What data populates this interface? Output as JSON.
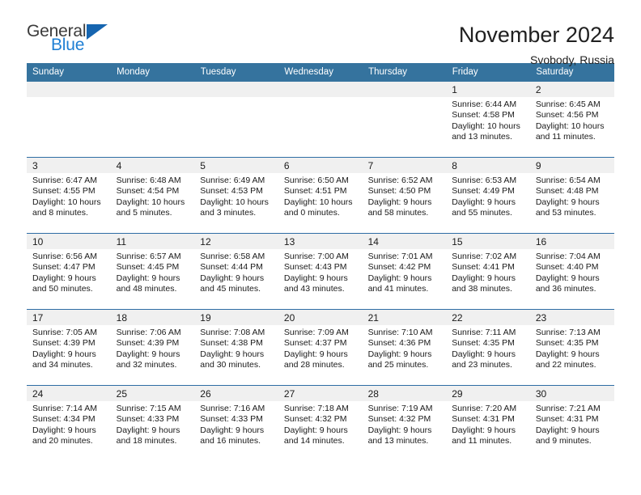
{
  "brand": {
    "line1": "General",
    "line2": "Blue",
    "mark_icon": "triangle-logo-icon",
    "accent_color": "#1f7fd4",
    "mark_color": "#1665b0"
  },
  "header": {
    "title": "November 2024",
    "subtitle": "Svobody, Russia"
  },
  "colors": {
    "header_blue": "#35739e",
    "row_border_blue": "#2e6da4",
    "daynum_bg": "#f0f0f0"
  },
  "calendar": {
    "weekday_headers": [
      "Sunday",
      "Monday",
      "Tuesday",
      "Wednesday",
      "Thursday",
      "Friday",
      "Saturday"
    ],
    "weeks": [
      [
        {
          "day": "",
          "sunrise": "",
          "sunset": "",
          "daylight": ""
        },
        {
          "day": "",
          "sunrise": "",
          "sunset": "",
          "daylight": ""
        },
        {
          "day": "",
          "sunrise": "",
          "sunset": "",
          "daylight": ""
        },
        {
          "day": "",
          "sunrise": "",
          "sunset": "",
          "daylight": ""
        },
        {
          "day": "",
          "sunrise": "",
          "sunset": "",
          "daylight": ""
        },
        {
          "day": "1",
          "sunrise": "Sunrise: 6:44 AM",
          "sunset": "Sunset: 4:58 PM",
          "daylight": "Daylight: 10 hours and 13 minutes."
        },
        {
          "day": "2",
          "sunrise": "Sunrise: 6:45 AM",
          "sunset": "Sunset: 4:56 PM",
          "daylight": "Daylight: 10 hours and 11 minutes."
        }
      ],
      [
        {
          "day": "3",
          "sunrise": "Sunrise: 6:47 AM",
          "sunset": "Sunset: 4:55 PM",
          "daylight": "Daylight: 10 hours and 8 minutes."
        },
        {
          "day": "4",
          "sunrise": "Sunrise: 6:48 AM",
          "sunset": "Sunset: 4:54 PM",
          "daylight": "Daylight: 10 hours and 5 minutes."
        },
        {
          "day": "5",
          "sunrise": "Sunrise: 6:49 AM",
          "sunset": "Sunset: 4:53 PM",
          "daylight": "Daylight: 10 hours and 3 minutes."
        },
        {
          "day": "6",
          "sunrise": "Sunrise: 6:50 AM",
          "sunset": "Sunset: 4:51 PM",
          "daylight": "Daylight: 10 hours and 0 minutes."
        },
        {
          "day": "7",
          "sunrise": "Sunrise: 6:52 AM",
          "sunset": "Sunset: 4:50 PM",
          "daylight": "Daylight: 9 hours and 58 minutes."
        },
        {
          "day": "8",
          "sunrise": "Sunrise: 6:53 AM",
          "sunset": "Sunset: 4:49 PM",
          "daylight": "Daylight: 9 hours and 55 minutes."
        },
        {
          "day": "9",
          "sunrise": "Sunrise: 6:54 AM",
          "sunset": "Sunset: 4:48 PM",
          "daylight": "Daylight: 9 hours and 53 minutes."
        }
      ],
      [
        {
          "day": "10",
          "sunrise": "Sunrise: 6:56 AM",
          "sunset": "Sunset: 4:47 PM",
          "daylight": "Daylight: 9 hours and 50 minutes."
        },
        {
          "day": "11",
          "sunrise": "Sunrise: 6:57 AM",
          "sunset": "Sunset: 4:45 PM",
          "daylight": "Daylight: 9 hours and 48 minutes."
        },
        {
          "day": "12",
          "sunrise": "Sunrise: 6:58 AM",
          "sunset": "Sunset: 4:44 PM",
          "daylight": "Daylight: 9 hours and 45 minutes."
        },
        {
          "day": "13",
          "sunrise": "Sunrise: 7:00 AM",
          "sunset": "Sunset: 4:43 PM",
          "daylight": "Daylight: 9 hours and 43 minutes."
        },
        {
          "day": "14",
          "sunrise": "Sunrise: 7:01 AM",
          "sunset": "Sunset: 4:42 PM",
          "daylight": "Daylight: 9 hours and 41 minutes."
        },
        {
          "day": "15",
          "sunrise": "Sunrise: 7:02 AM",
          "sunset": "Sunset: 4:41 PM",
          "daylight": "Daylight: 9 hours and 38 minutes."
        },
        {
          "day": "16",
          "sunrise": "Sunrise: 7:04 AM",
          "sunset": "Sunset: 4:40 PM",
          "daylight": "Daylight: 9 hours and 36 minutes."
        }
      ],
      [
        {
          "day": "17",
          "sunrise": "Sunrise: 7:05 AM",
          "sunset": "Sunset: 4:39 PM",
          "daylight": "Daylight: 9 hours and 34 minutes."
        },
        {
          "day": "18",
          "sunrise": "Sunrise: 7:06 AM",
          "sunset": "Sunset: 4:39 PM",
          "daylight": "Daylight: 9 hours and 32 minutes."
        },
        {
          "day": "19",
          "sunrise": "Sunrise: 7:08 AM",
          "sunset": "Sunset: 4:38 PM",
          "daylight": "Daylight: 9 hours and 30 minutes."
        },
        {
          "day": "20",
          "sunrise": "Sunrise: 7:09 AM",
          "sunset": "Sunset: 4:37 PM",
          "daylight": "Daylight: 9 hours and 28 minutes."
        },
        {
          "day": "21",
          "sunrise": "Sunrise: 7:10 AM",
          "sunset": "Sunset: 4:36 PM",
          "daylight": "Daylight: 9 hours and 25 minutes."
        },
        {
          "day": "22",
          "sunrise": "Sunrise: 7:11 AM",
          "sunset": "Sunset: 4:35 PM",
          "daylight": "Daylight: 9 hours and 23 minutes."
        },
        {
          "day": "23",
          "sunrise": "Sunrise: 7:13 AM",
          "sunset": "Sunset: 4:35 PM",
          "daylight": "Daylight: 9 hours and 22 minutes."
        }
      ],
      [
        {
          "day": "24",
          "sunrise": "Sunrise: 7:14 AM",
          "sunset": "Sunset: 4:34 PM",
          "daylight": "Daylight: 9 hours and 20 minutes."
        },
        {
          "day": "25",
          "sunrise": "Sunrise: 7:15 AM",
          "sunset": "Sunset: 4:33 PM",
          "daylight": "Daylight: 9 hours and 18 minutes."
        },
        {
          "day": "26",
          "sunrise": "Sunrise: 7:16 AM",
          "sunset": "Sunset: 4:33 PM",
          "daylight": "Daylight: 9 hours and 16 minutes."
        },
        {
          "day": "27",
          "sunrise": "Sunrise: 7:18 AM",
          "sunset": "Sunset: 4:32 PM",
          "daylight": "Daylight: 9 hours and 14 minutes."
        },
        {
          "day": "28",
          "sunrise": "Sunrise: 7:19 AM",
          "sunset": "Sunset: 4:32 PM",
          "daylight": "Daylight: 9 hours and 13 minutes."
        },
        {
          "day": "29",
          "sunrise": "Sunrise: 7:20 AM",
          "sunset": "Sunset: 4:31 PM",
          "daylight": "Daylight: 9 hours and 11 minutes."
        },
        {
          "day": "30",
          "sunrise": "Sunrise: 7:21 AM",
          "sunset": "Sunset: 4:31 PM",
          "daylight": "Daylight: 9 hours and 9 minutes."
        }
      ]
    ]
  }
}
